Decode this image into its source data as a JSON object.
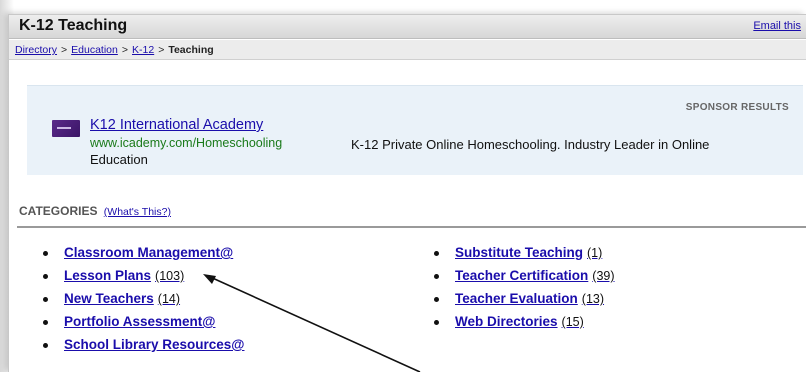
{
  "header": {
    "title": "K-12 Teaching",
    "email_link": "Email this"
  },
  "breadcrumb": {
    "items": [
      "Directory",
      "Education",
      "K-12"
    ],
    "separator": ">",
    "current": "Teaching"
  },
  "sponsor": {
    "label": "SPONSOR RESULTS",
    "title": "K12 International Academy",
    "url": "www.icademy.com/Homeschooling",
    "description_line1": "K-12 Private Online Homeschooling. Industry Leader in Online",
    "description_line2": "Education"
  },
  "categories": {
    "heading": "CATEGORIES",
    "whats_this": "(What's This?)",
    "left": [
      {
        "label": "Classroom Management@",
        "count": ""
      },
      {
        "label": "Lesson Plans",
        "count": "(103)"
      },
      {
        "label": "New Teachers",
        "count": "(14)"
      },
      {
        "label": "Portfolio Assessment@",
        "count": ""
      },
      {
        "label": "School Library Resources@",
        "count": ""
      }
    ],
    "right": [
      {
        "label": "Substitute Teaching",
        "count": "(1)"
      },
      {
        "label": "Teacher Certification",
        "count": "(39)"
      },
      {
        "label": "Teacher Evaluation",
        "count": "(13)"
      },
      {
        "label": "Web Directories",
        "count": "(15)"
      }
    ]
  },
  "colors": {
    "link": "#1a0dab",
    "sponsor_bg": "#eaf2f9",
    "url_green": "#1a7a1a"
  }
}
